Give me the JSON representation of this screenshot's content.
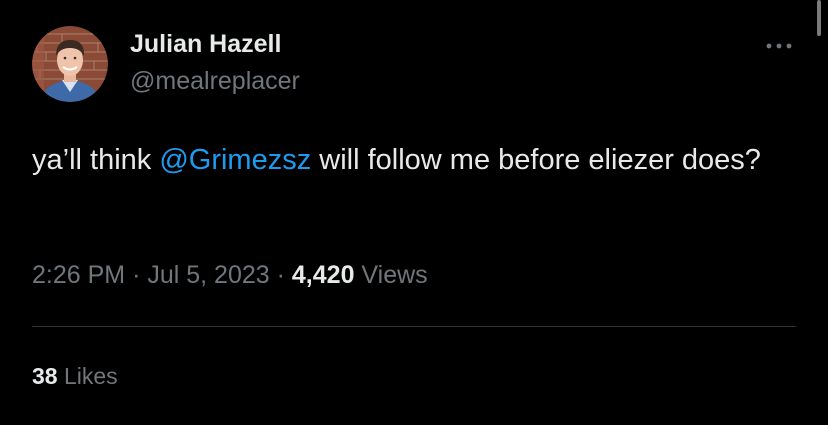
{
  "author": {
    "display_name": "Julian Hazell",
    "handle": "@mealreplacer",
    "avatar_icon": "profile-photo-avatar"
  },
  "tweet": {
    "text_before": "ya’ll think ",
    "mention": "@Grimezsz",
    "text_after": " will follow me before eliezer does?"
  },
  "meta": {
    "time": "2:26 PM",
    "separator": "·",
    "date": "Jul 5, 2023",
    "views_count": "4,420",
    "views_label": "Views"
  },
  "engagement": {
    "likes_count": "38",
    "likes_label": "Likes"
  },
  "icons": {
    "more": "more-horizontal-icon"
  },
  "colors": {
    "background": "#000000",
    "text": "#e7e9ea",
    "secondary": "#71767b",
    "link": "#1d9bf0",
    "divider": "#2f3336"
  }
}
